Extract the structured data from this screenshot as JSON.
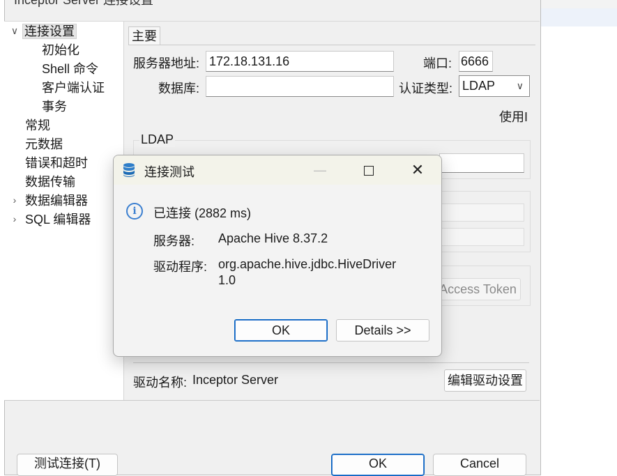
{
  "window": {
    "title": "Inceptor Server 连接设置"
  },
  "tree": {
    "items": [
      {
        "label": "连接设置",
        "expanded": true,
        "selected": true
      },
      {
        "label": "初始化"
      },
      {
        "label": "Shell 命令"
      },
      {
        "label": "客户端认证"
      },
      {
        "label": "事务"
      },
      {
        "label": "常规"
      },
      {
        "label": "元数据"
      },
      {
        "label": "错误和超时"
      },
      {
        "label": "数据传输"
      },
      {
        "label": "数据编辑器",
        "expandable": true
      },
      {
        "label": "SQL 编辑器",
        "expandable": true
      }
    ]
  },
  "main": {
    "tab": "主要",
    "server_label": "服务器地址:",
    "server_value": "172.18.131.16",
    "port_label": "端口:",
    "port_value": "6666",
    "database_label": "数据库:",
    "database_value": "",
    "auth_type_label": "认证类型:",
    "auth_type_value": "LDAP",
    "use_text": "使用I",
    "ldap_group": "LDAP",
    "access_token_button": "Access Token",
    "driver_name_label": "驱动名称:",
    "driver_name_value": "Inceptor Server",
    "edit_driver_button": "编辑驱动设置"
  },
  "bottom": {
    "test_connection_button": "测试连接(T)",
    "ok_button": "OK",
    "cancel_button": "Cancel"
  },
  "dialog": {
    "title": "连接测试",
    "status": "已连接 (2882 ms)",
    "server_label": "服务器:",
    "server_value": "Apache Hive 8.37.2",
    "driver_label": "驱动程序:",
    "driver_value_line1": "org.apache.hive.jdbc.HiveDriver",
    "driver_value_line2": "1.0",
    "ok_button": "OK",
    "details_button": "Details >>",
    "colors": {
      "accent": "#3b7fd0",
      "title_bar": "#f3f3ea"
    }
  }
}
